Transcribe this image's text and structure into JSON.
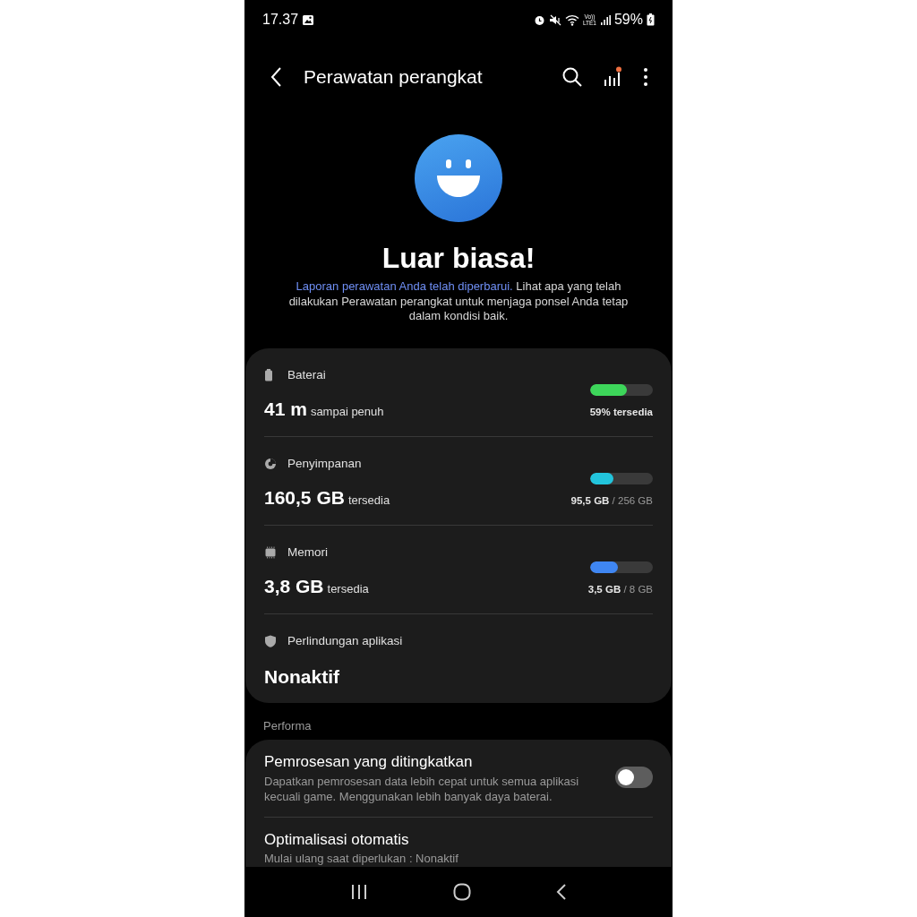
{
  "status_bar": {
    "time": "17.37",
    "volte_top": "Vo))",
    "volte_bottom": "LTE1",
    "battery": "59%"
  },
  "app_bar": {
    "title": "Perawatan perangkat",
    "notification_dot": true
  },
  "hero": {
    "title": "Luar biasa!",
    "link": "Laporan perawatan Anda telah diperbarui.",
    "message": "Lihat apa yang telah dilakukan Perawatan perangkat untuk menjaga ponsel Anda tetap dalam kondisi baik."
  },
  "status_items": [
    {
      "kind": "meter",
      "label": "Baterai",
      "value": "41 m",
      "unit": "sampai penuh",
      "level": 0.59,
      "color": "#3dd65a",
      "reading": "59% tersedia"
    },
    {
      "kind": "meter",
      "label": "Penyimpanan",
      "value": "160,5 GB",
      "unit": "tersedia",
      "level": 0.37,
      "color": "#22c4dc",
      "reading": "**95,5 GB** / 256 GB"
    },
    {
      "kind": "meter",
      "label": "Memori",
      "value": "3,8 GB",
      "unit": "tersedia",
      "level": 0.44,
      "color": "#3f86f2",
      "reading": "**3,5 GB** / 8 GB"
    },
    {
      "kind": "status",
      "label": "Perlindungan aplikasi",
      "value": "Nonaktif"
    }
  ],
  "section_title": "Performa",
  "settings": [
    {
      "kind": "toggle",
      "title": "Pemrosesan yang ditingkatkan",
      "description": "Dapatkan pemrosesan data lebih cepat untuk semua aplikasi kecuali game. Menggunakan lebih banyak daya baterai.",
      "on": false
    },
    {
      "kind": "plain",
      "title": "Optimalisasi otomatis",
      "description": "Mulai ulang saat diperlukan : Nonaktif"
    }
  ]
}
